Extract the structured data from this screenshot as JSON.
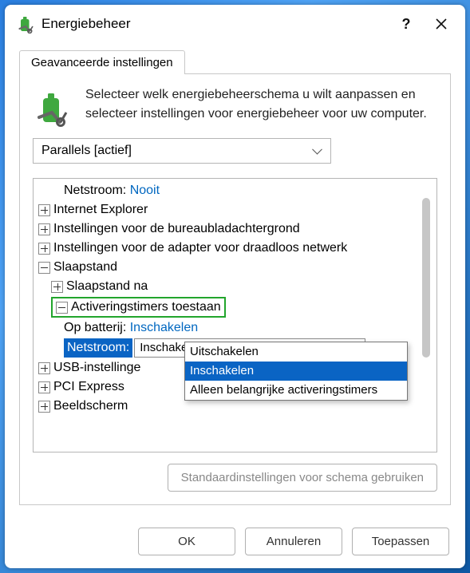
{
  "title": "Energiebeheer",
  "tab": {
    "active_label": "Geavanceerde instellingen"
  },
  "intro": "Selecteer welk energiebeheerschema u wilt aanpassen en selecteer instellingen voor energiebeheer voor uw computer.",
  "plan_selected": "Parallels [actief]",
  "tree": {
    "netstroom_label": "Netstroom:",
    "netstroom_value": "Nooit",
    "ie": "Internet Explorer",
    "desktop_bg": "Instellingen voor de bureaubladachtergrond",
    "wifi": "Instellingen voor de adapter voor draadloos netwerk",
    "sleep": "Slaapstand",
    "sleep_after": "Slaapstand na",
    "wake_timers": "Activeringstimers toestaan",
    "on_battery_label": "Op batterij:",
    "on_battery_value": "Inschakelen",
    "netstroom2_label": "Netstroom:",
    "netstroom2_value": "Inschakelen",
    "usb": "USB-instellinge",
    "pci": "PCI Express",
    "display": "Beeldscherm"
  },
  "dropdown": {
    "opt0": "Uitschakelen",
    "opt1": "Inschakelen",
    "opt2": "Alleen belangrijke activeringstimers"
  },
  "buttons": {
    "defaults": "Standaardinstellingen voor schema gebruiken",
    "ok": "OK",
    "cancel": "Annuleren",
    "apply": "Toepassen"
  }
}
